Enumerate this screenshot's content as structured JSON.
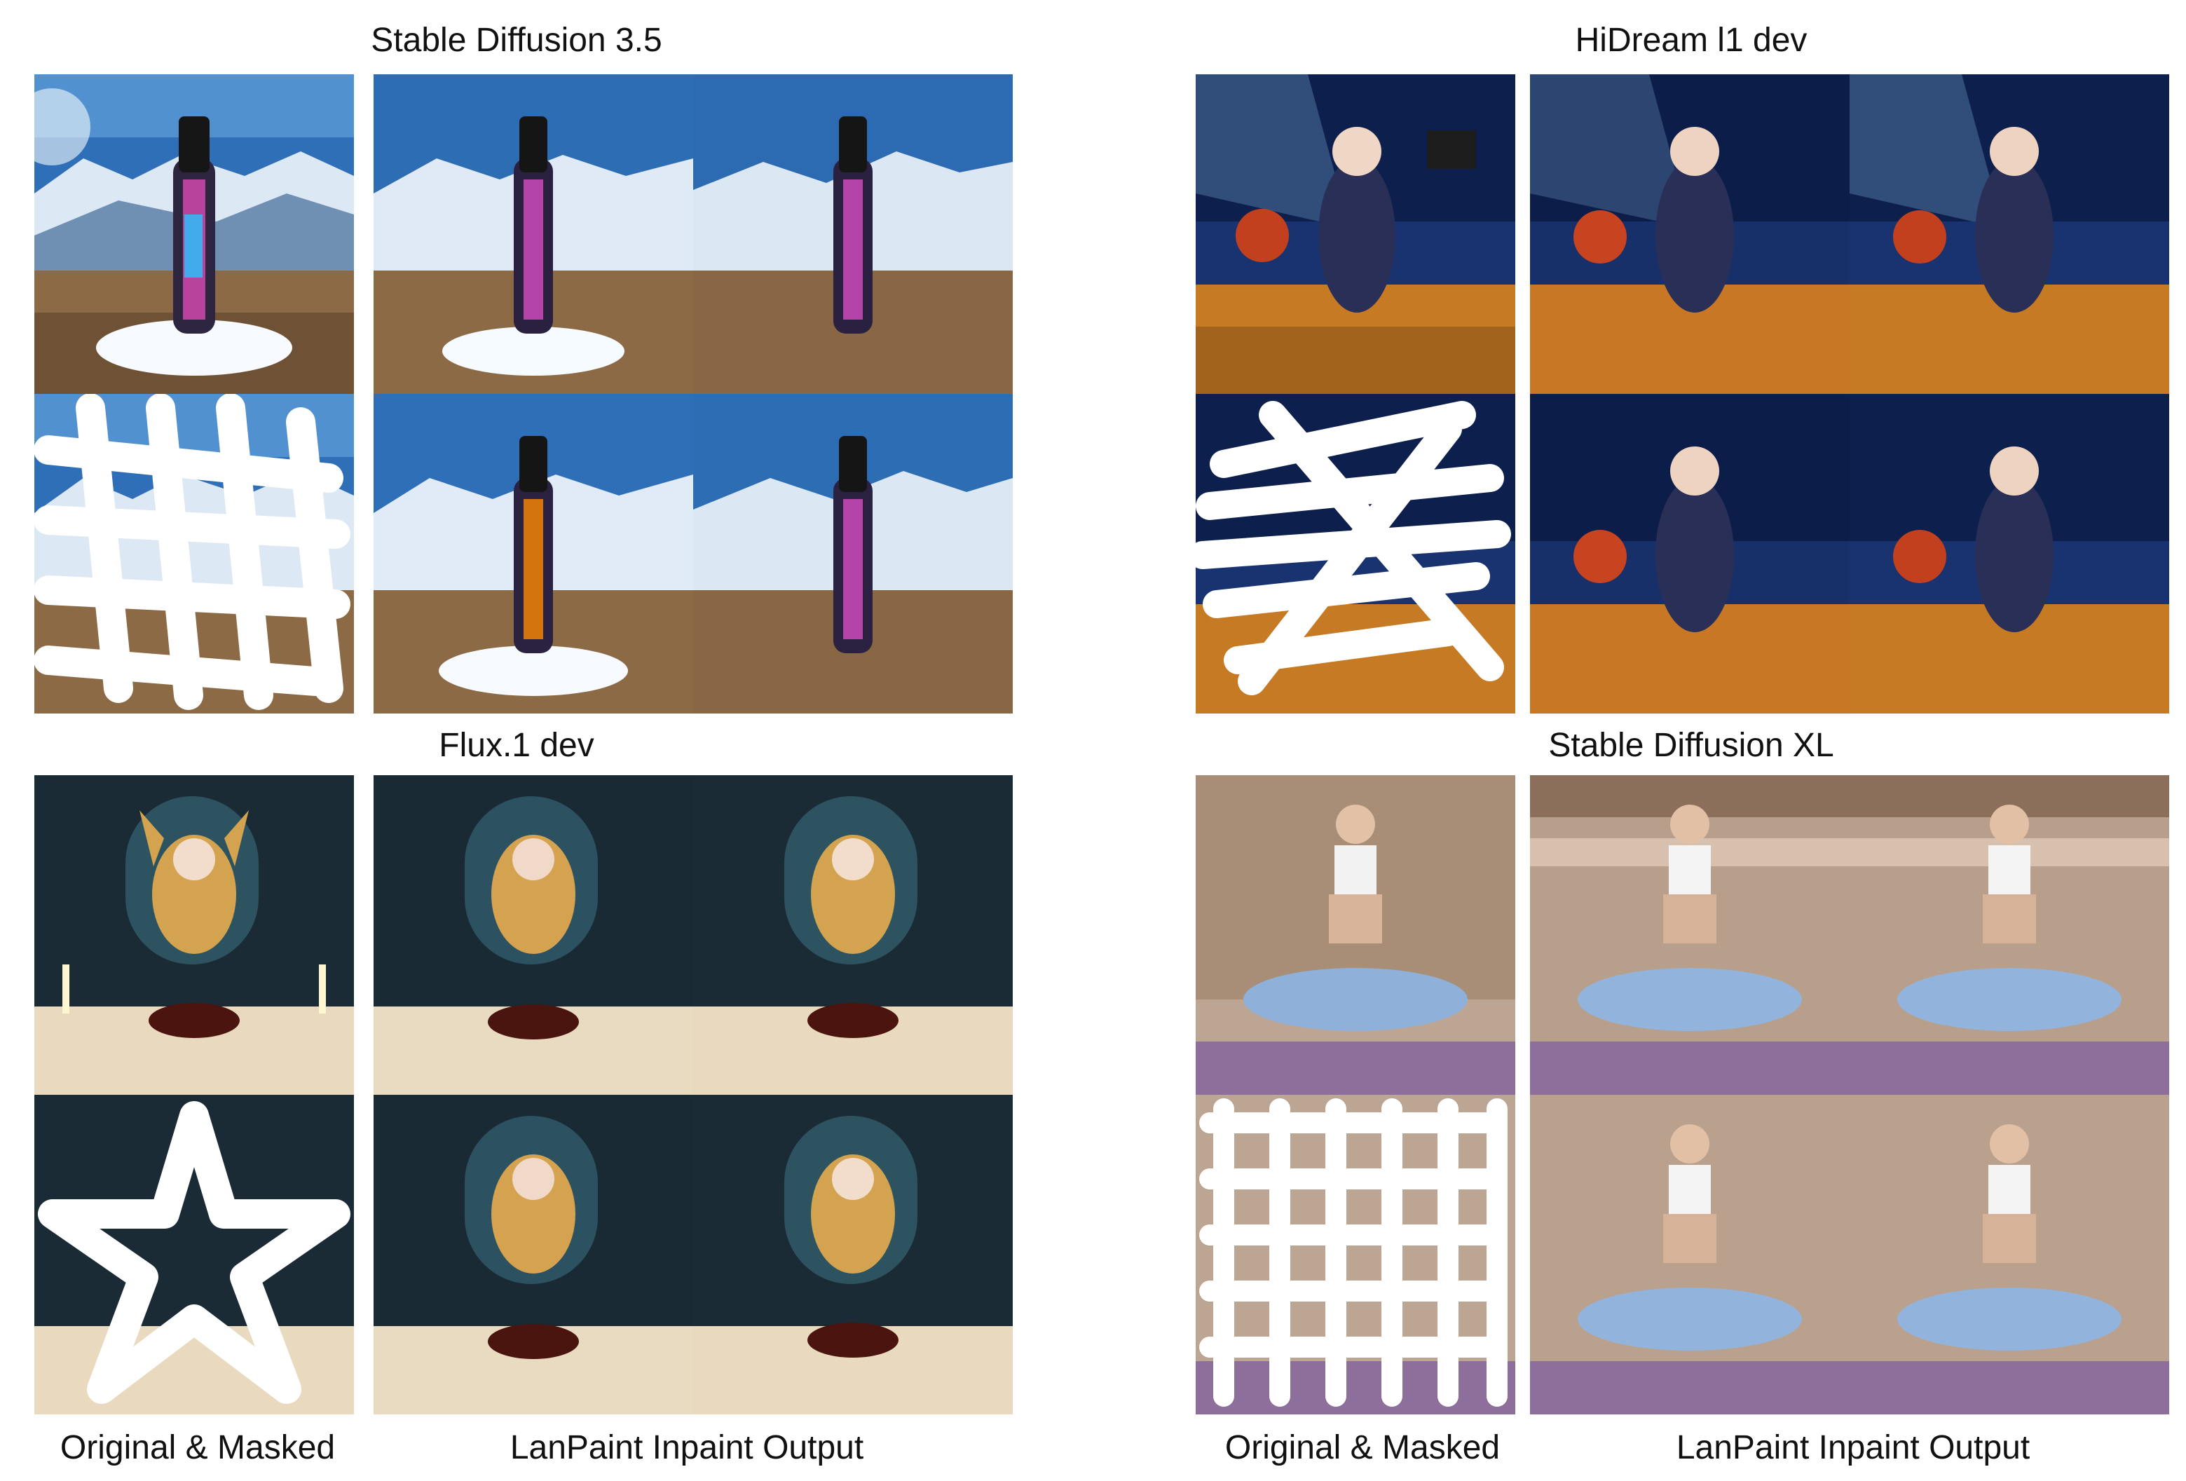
{
  "panels": [
    {
      "title": "Stable Diffusion 3.5",
      "theme": "bottle"
    },
    {
      "title": "HiDream l1 dev",
      "theme": "basketball"
    },
    {
      "title": "Flux.1 dev",
      "theme": "fox"
    },
    {
      "title": "Stable Diffusion XL",
      "theme": "yoga"
    }
  ],
  "captions": {
    "left_original": "Original & Masked",
    "left_output": "LanPaint Inpaint Output",
    "right_original": "Original & Masked",
    "right_output": "LanPaint Inpaint Output"
  },
  "images": [
    {
      "panel": "bottle",
      "role": "original"
    },
    {
      "panel": "bottle",
      "role": "masked"
    },
    {
      "panel": "bottle",
      "role": "output-1"
    },
    {
      "panel": "bottle",
      "role": "output-2"
    },
    {
      "panel": "bottle",
      "role": "output-3"
    },
    {
      "panel": "bottle",
      "role": "output-4"
    },
    {
      "panel": "basketball",
      "role": "original"
    },
    {
      "panel": "basketball",
      "role": "masked"
    },
    {
      "panel": "basketball",
      "role": "output-1"
    },
    {
      "panel": "basketball",
      "role": "output-2"
    },
    {
      "panel": "basketball",
      "role": "output-3"
    },
    {
      "panel": "basketball",
      "role": "output-4"
    },
    {
      "panel": "fox",
      "role": "original"
    },
    {
      "panel": "fox",
      "role": "masked"
    },
    {
      "panel": "fox",
      "role": "output-1"
    },
    {
      "panel": "fox",
      "role": "output-2"
    },
    {
      "panel": "fox",
      "role": "output-3"
    },
    {
      "panel": "fox",
      "role": "output-4"
    },
    {
      "panel": "yoga",
      "role": "original"
    },
    {
      "panel": "yoga",
      "role": "masked"
    },
    {
      "panel": "yoga",
      "role": "output-1"
    },
    {
      "panel": "yoga",
      "role": "output-2"
    },
    {
      "panel": "yoga",
      "role": "output-3"
    },
    {
      "panel": "yoga",
      "role": "output-4"
    }
  ]
}
